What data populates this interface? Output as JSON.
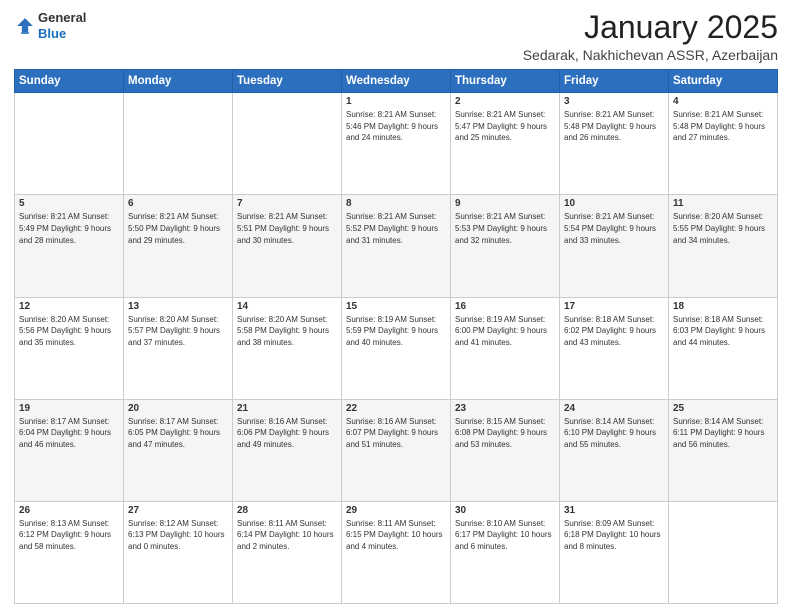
{
  "header": {
    "logo": {
      "general": "General",
      "blue": "Blue"
    },
    "title": "January 2025",
    "subtitle": "Sedarak, Nakhichevan ASSR, Azerbaijan"
  },
  "days_of_week": [
    "Sunday",
    "Monday",
    "Tuesday",
    "Wednesday",
    "Thursday",
    "Friday",
    "Saturday"
  ],
  "weeks": [
    [
      {
        "day": "",
        "info": ""
      },
      {
        "day": "",
        "info": ""
      },
      {
        "day": "",
        "info": ""
      },
      {
        "day": "1",
        "info": "Sunrise: 8:21 AM\nSunset: 5:46 PM\nDaylight: 9 hours and 24 minutes."
      },
      {
        "day": "2",
        "info": "Sunrise: 8:21 AM\nSunset: 5:47 PM\nDaylight: 9 hours and 25 minutes."
      },
      {
        "day": "3",
        "info": "Sunrise: 8:21 AM\nSunset: 5:48 PM\nDaylight: 9 hours and 26 minutes."
      },
      {
        "day": "4",
        "info": "Sunrise: 8:21 AM\nSunset: 5:48 PM\nDaylight: 9 hours and 27 minutes."
      }
    ],
    [
      {
        "day": "5",
        "info": "Sunrise: 8:21 AM\nSunset: 5:49 PM\nDaylight: 9 hours and 28 minutes."
      },
      {
        "day": "6",
        "info": "Sunrise: 8:21 AM\nSunset: 5:50 PM\nDaylight: 9 hours and 29 minutes."
      },
      {
        "day": "7",
        "info": "Sunrise: 8:21 AM\nSunset: 5:51 PM\nDaylight: 9 hours and 30 minutes."
      },
      {
        "day": "8",
        "info": "Sunrise: 8:21 AM\nSunset: 5:52 PM\nDaylight: 9 hours and 31 minutes."
      },
      {
        "day": "9",
        "info": "Sunrise: 8:21 AM\nSunset: 5:53 PM\nDaylight: 9 hours and 32 minutes."
      },
      {
        "day": "10",
        "info": "Sunrise: 8:21 AM\nSunset: 5:54 PM\nDaylight: 9 hours and 33 minutes."
      },
      {
        "day": "11",
        "info": "Sunrise: 8:20 AM\nSunset: 5:55 PM\nDaylight: 9 hours and 34 minutes."
      }
    ],
    [
      {
        "day": "12",
        "info": "Sunrise: 8:20 AM\nSunset: 5:56 PM\nDaylight: 9 hours and 35 minutes."
      },
      {
        "day": "13",
        "info": "Sunrise: 8:20 AM\nSunset: 5:57 PM\nDaylight: 9 hours and 37 minutes."
      },
      {
        "day": "14",
        "info": "Sunrise: 8:20 AM\nSunset: 5:58 PM\nDaylight: 9 hours and 38 minutes."
      },
      {
        "day": "15",
        "info": "Sunrise: 8:19 AM\nSunset: 5:59 PM\nDaylight: 9 hours and 40 minutes."
      },
      {
        "day": "16",
        "info": "Sunrise: 8:19 AM\nSunset: 6:00 PM\nDaylight: 9 hours and 41 minutes."
      },
      {
        "day": "17",
        "info": "Sunrise: 8:18 AM\nSunset: 6:02 PM\nDaylight: 9 hours and 43 minutes."
      },
      {
        "day": "18",
        "info": "Sunrise: 8:18 AM\nSunset: 6:03 PM\nDaylight: 9 hours and 44 minutes."
      }
    ],
    [
      {
        "day": "19",
        "info": "Sunrise: 8:17 AM\nSunset: 6:04 PM\nDaylight: 9 hours and 46 minutes."
      },
      {
        "day": "20",
        "info": "Sunrise: 8:17 AM\nSunset: 6:05 PM\nDaylight: 9 hours and 47 minutes."
      },
      {
        "day": "21",
        "info": "Sunrise: 8:16 AM\nSunset: 6:06 PM\nDaylight: 9 hours and 49 minutes."
      },
      {
        "day": "22",
        "info": "Sunrise: 8:16 AM\nSunset: 6:07 PM\nDaylight: 9 hours and 51 minutes."
      },
      {
        "day": "23",
        "info": "Sunrise: 8:15 AM\nSunset: 6:08 PM\nDaylight: 9 hours and 53 minutes."
      },
      {
        "day": "24",
        "info": "Sunrise: 8:14 AM\nSunset: 6:10 PM\nDaylight: 9 hours and 55 minutes."
      },
      {
        "day": "25",
        "info": "Sunrise: 8:14 AM\nSunset: 6:11 PM\nDaylight: 9 hours and 56 minutes."
      }
    ],
    [
      {
        "day": "26",
        "info": "Sunrise: 8:13 AM\nSunset: 6:12 PM\nDaylight: 9 hours and 58 minutes."
      },
      {
        "day": "27",
        "info": "Sunrise: 8:12 AM\nSunset: 6:13 PM\nDaylight: 10 hours and 0 minutes."
      },
      {
        "day": "28",
        "info": "Sunrise: 8:11 AM\nSunset: 6:14 PM\nDaylight: 10 hours and 2 minutes."
      },
      {
        "day": "29",
        "info": "Sunrise: 8:11 AM\nSunset: 6:15 PM\nDaylight: 10 hours and 4 minutes."
      },
      {
        "day": "30",
        "info": "Sunrise: 8:10 AM\nSunset: 6:17 PM\nDaylight: 10 hours and 6 minutes."
      },
      {
        "day": "31",
        "info": "Sunrise: 8:09 AM\nSunset: 6:18 PM\nDaylight: 10 hours and 8 minutes."
      },
      {
        "day": "",
        "info": ""
      }
    ]
  ]
}
